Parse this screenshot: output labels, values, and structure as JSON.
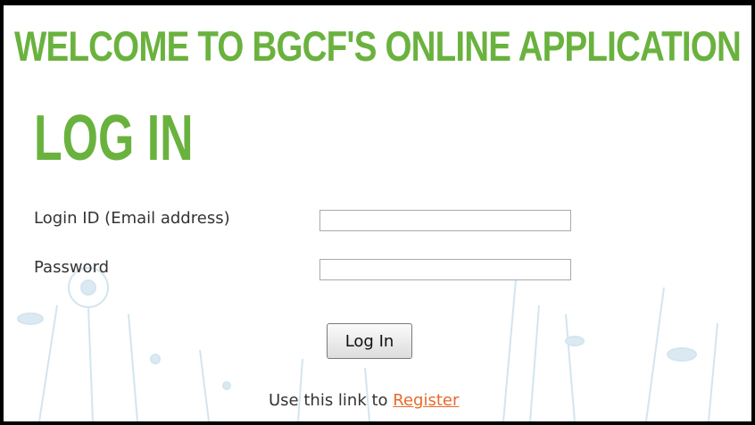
{
  "header": {
    "banner_text": "WELCOME TO BGCF'S ONLINE APPLICATION PORTAL"
  },
  "page": {
    "title": "LOG IN"
  },
  "form": {
    "login_id_label": "Login ID (Email address)",
    "login_id_value": "",
    "password_label": "Password",
    "password_value": "",
    "submit_label": "Log In"
  },
  "footer": {
    "register_prefix": "Use this link to",
    "register_link_label": "Register"
  },
  "colors": {
    "brand_green": "#6ab23e",
    "link_orange": "#e86a2c",
    "background_art_blue": "#cfe3ee"
  }
}
